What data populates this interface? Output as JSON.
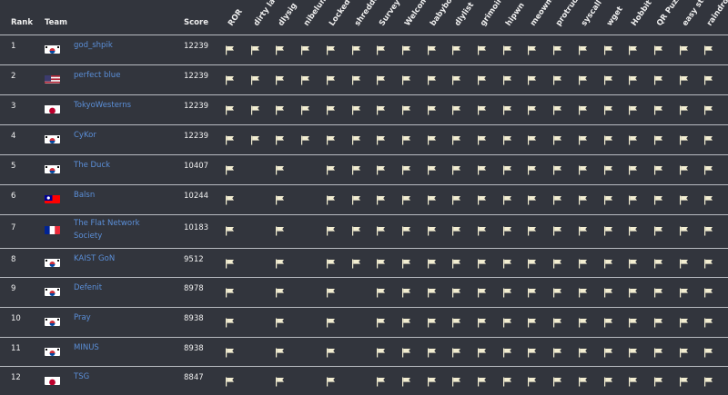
{
  "headers": {
    "rank": "Rank",
    "team": "Team",
    "score": "Score"
  },
  "challenges": [
    "ROR",
    "dirty laundry",
    "dlysig",
    "nibelung",
    "Locked",
    "shredder",
    "Survey",
    "Welcome",
    "babybof",
    "dlylist",
    "grimoire",
    "hipwn",
    "meowmow",
    "protruding",
    "syscall kit",
    "wget",
    "Hobbit",
    "QR Puzzle",
    "easy strcmp",
    "raindrop"
  ],
  "colors": {
    "flag_icon": "#f3eed2",
    "team_link": "#5b8fd8",
    "divider": "#b9bcc2"
  },
  "rows": [
    {
      "rank": "1",
      "country": "KR",
      "team": "god_shpik",
      "score": "12239",
      "solves": [
        1,
        1,
        1,
        1,
        1,
        1,
        1,
        1,
        1,
        1,
        1,
        1,
        1,
        1,
        1,
        1,
        1,
        1,
        1,
        1
      ]
    },
    {
      "rank": "2",
      "country": "US",
      "team": "perfect blue",
      "score": "12239",
      "solves": [
        1,
        1,
        1,
        1,
        1,
        1,
        1,
        1,
        1,
        1,
        1,
        1,
        1,
        1,
        1,
        1,
        1,
        1,
        1,
        1
      ]
    },
    {
      "rank": "3",
      "country": "JP",
      "team": "TokyoWesterns",
      "score": "12239",
      "solves": [
        1,
        1,
        1,
        1,
        1,
        1,
        1,
        1,
        1,
        1,
        1,
        1,
        1,
        1,
        1,
        1,
        1,
        1,
        1,
        1
      ]
    },
    {
      "rank": "4",
      "country": "KR",
      "team": "CyKor",
      "score": "12239",
      "solves": [
        1,
        1,
        1,
        1,
        1,
        1,
        1,
        1,
        1,
        1,
        1,
        1,
        1,
        1,
        1,
        1,
        1,
        1,
        1,
        1
      ]
    },
    {
      "rank": "5",
      "country": "KR",
      "team": "The Duck",
      "score": "10407",
      "solves": [
        1,
        0,
        1,
        0,
        1,
        1,
        1,
        1,
        1,
        1,
        1,
        1,
        1,
        1,
        1,
        1,
        1,
        1,
        1,
        1
      ]
    },
    {
      "rank": "6",
      "country": "TW",
      "team": "Balsn",
      "score": "10244",
      "solves": [
        1,
        0,
        1,
        0,
        1,
        1,
        1,
        1,
        1,
        1,
        1,
        1,
        1,
        1,
        1,
        1,
        1,
        1,
        1,
        1
      ]
    },
    {
      "rank": "7",
      "country": "FR",
      "team": "The Flat Network Society",
      "score": "10183",
      "solves": [
        1,
        0,
        1,
        0,
        1,
        1,
        1,
        1,
        1,
        1,
        1,
        1,
        1,
        1,
        1,
        1,
        1,
        1,
        1,
        1
      ]
    },
    {
      "rank": "8",
      "country": "KR",
      "team": "KAIST GoN",
      "score": "9512",
      "solves": [
        1,
        0,
        1,
        0,
        1,
        1,
        1,
        1,
        1,
        1,
        1,
        1,
        1,
        1,
        1,
        1,
        1,
        1,
        1,
        1
      ]
    },
    {
      "rank": "9",
      "country": "KR",
      "team": "Defenit",
      "score": "8978",
      "solves": [
        1,
        0,
        1,
        0,
        1,
        0,
        1,
        1,
        1,
        1,
        1,
        1,
        1,
        1,
        1,
        1,
        1,
        1,
        1,
        1
      ]
    },
    {
      "rank": "10",
      "country": "KR",
      "team": "Pray",
      "score": "8938",
      "solves": [
        1,
        0,
        1,
        0,
        1,
        0,
        1,
        1,
        1,
        1,
        1,
        1,
        1,
        1,
        1,
        1,
        1,
        1,
        1,
        1
      ]
    },
    {
      "rank": "11",
      "country": "KR",
      "team": "MINUS",
      "score": "8938",
      "solves": [
        1,
        0,
        1,
        0,
        1,
        0,
        1,
        1,
        1,
        1,
        1,
        1,
        1,
        1,
        1,
        1,
        1,
        1,
        1,
        1
      ]
    },
    {
      "rank": "12",
      "country": "JP",
      "team": "TSG",
      "score": "8847",
      "solves": [
        1,
        0,
        1,
        0,
        1,
        0,
        1,
        1,
        1,
        1,
        1,
        1,
        1,
        1,
        1,
        1,
        1,
        1,
        1,
        1
      ]
    }
  ]
}
